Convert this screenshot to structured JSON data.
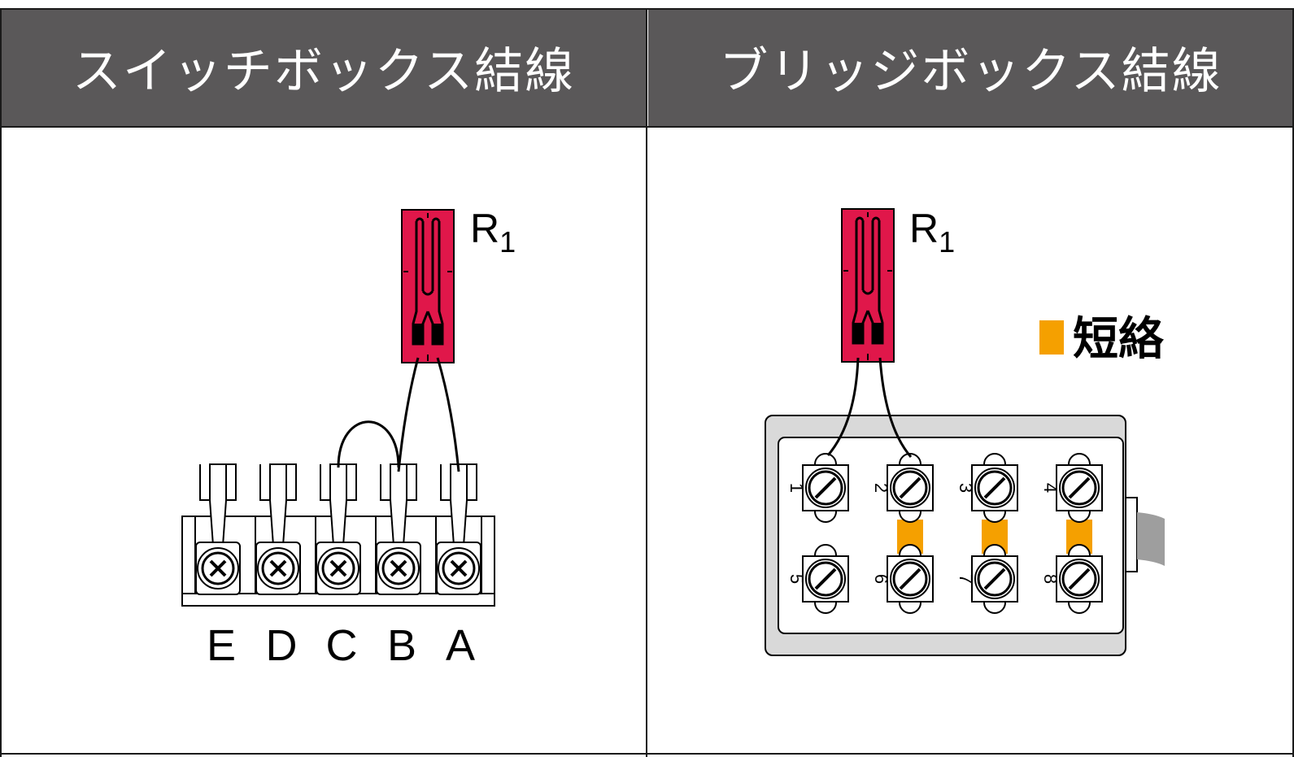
{
  "columns": [
    {
      "title": "スイッチボックス結線"
    },
    {
      "title": "ブリッジボックス結線"
    }
  ],
  "switch_box": {
    "gauge_label_main": "R",
    "gauge_label_sub": "1",
    "terminals": [
      "E",
      "D",
      "C",
      "B",
      "A"
    ]
  },
  "bridge_box": {
    "gauge_label_main": "R",
    "gauge_label_sub": "1",
    "legend_label": "短絡",
    "terminal_numbers": [
      "1",
      "2",
      "3",
      "4",
      "5",
      "6",
      "7",
      "8"
    ]
  },
  "colors": {
    "header_bg": "#5a5859",
    "gauge": "#e0174a",
    "short": "#f5a000",
    "box": "#d9d9d9"
  }
}
